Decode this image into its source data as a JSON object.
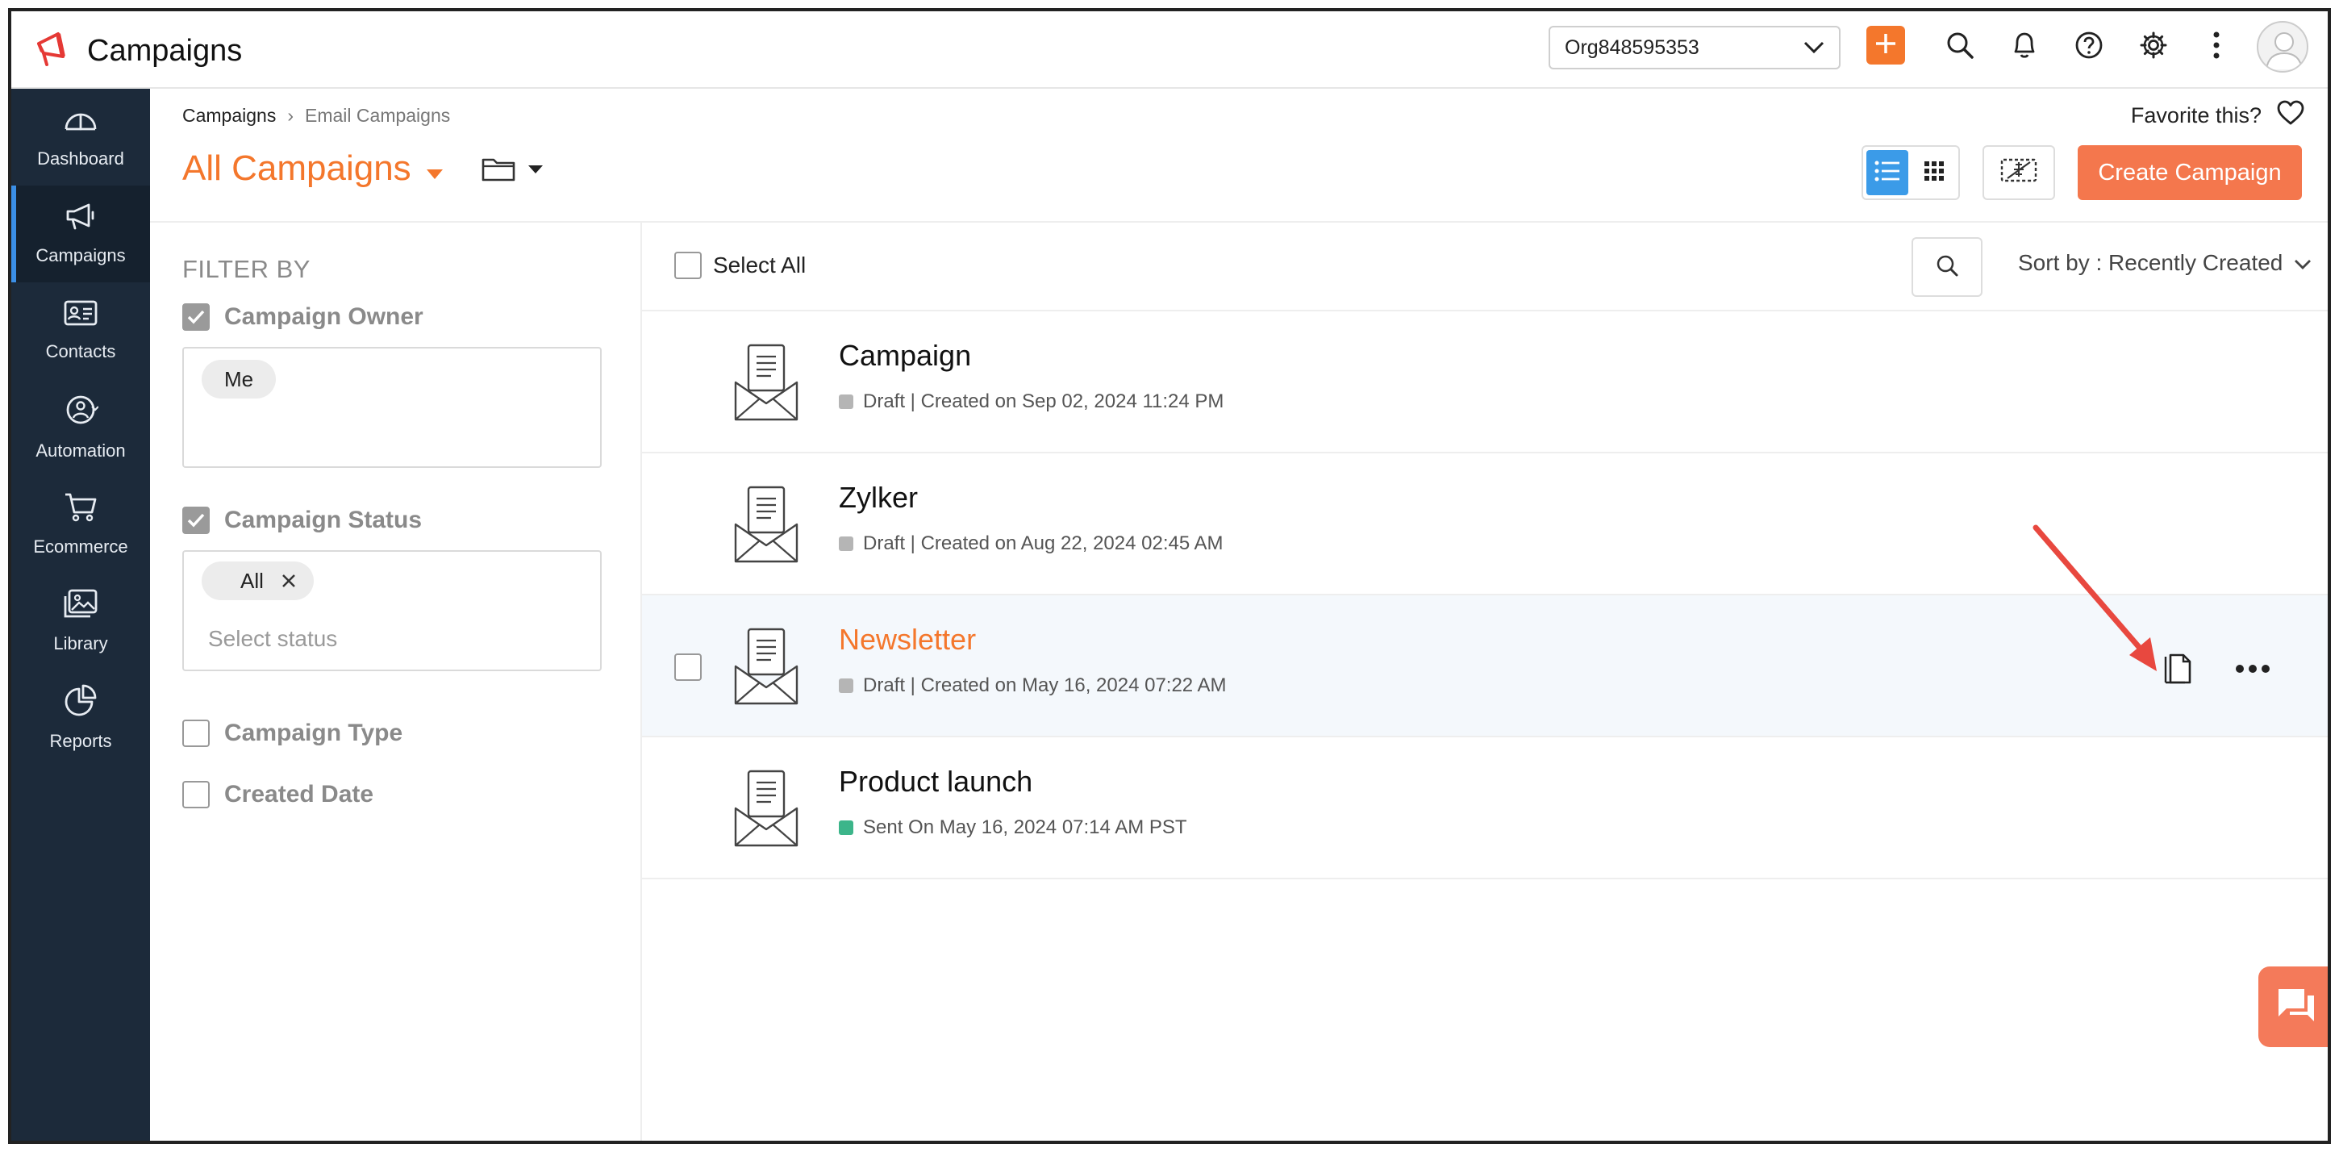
{
  "app": {
    "title": "Campaigns"
  },
  "topbar": {
    "org_selected": "Org848595353"
  },
  "nav": {
    "items": [
      {
        "label": "Dashboard",
        "icon": "gauge-icon",
        "active": false
      },
      {
        "label": "Campaigns",
        "icon": "megaphone-icon",
        "active": true
      },
      {
        "label": "Contacts",
        "icon": "contact-card-icon",
        "active": false
      },
      {
        "label": "Automation",
        "icon": "automation-icon",
        "active": false
      },
      {
        "label": "Ecommerce",
        "icon": "cart-icon",
        "active": false
      },
      {
        "label": "Library",
        "icon": "image-library-icon",
        "active": false
      },
      {
        "label": "Reports",
        "icon": "pie-chart-icon",
        "active": false
      }
    ]
  },
  "breadcrumb": {
    "root": "Campaigns",
    "separator": "›",
    "current": "Email Campaigns"
  },
  "header": {
    "favorite_label": "Favorite this?",
    "page_title": "All Campaigns",
    "create_label": "Create Campaign"
  },
  "filter": {
    "title": "FILTER BY",
    "owner_label": "Campaign Owner",
    "owner_tag": "Me",
    "status_label": "Campaign Status",
    "status_tag": "All",
    "status_placeholder": "Select status",
    "type_label": "Campaign Type",
    "date_label": "Created Date"
  },
  "list": {
    "select_all_label": "Select All",
    "sort_label": "Sort by : Recently Created",
    "rows": [
      {
        "title": "Campaign",
        "meta": "Draft | Created on Sep 02, 2024 11:24 PM",
        "status_color": "#b5b5b5"
      },
      {
        "title": "Zylker",
        "meta": "Draft | Created on Aug 22, 2024 02:45 AM",
        "status_color": "#b5b5b5"
      },
      {
        "title": "Newsletter",
        "meta": "Draft | Created on May 16, 2024 07:22 AM",
        "status_color": "#b5b5b5"
      },
      {
        "title": "Product launch",
        "meta": "Sent On May 16, 2024 07:14 AM PST",
        "status_color": "#3cb58a"
      }
    ]
  },
  "colors": {
    "accent": "#f4772c",
    "nav_bg": "#1c2a3a",
    "toggle_active": "#3b9be8",
    "annotation_arrow": "#e8483f"
  }
}
